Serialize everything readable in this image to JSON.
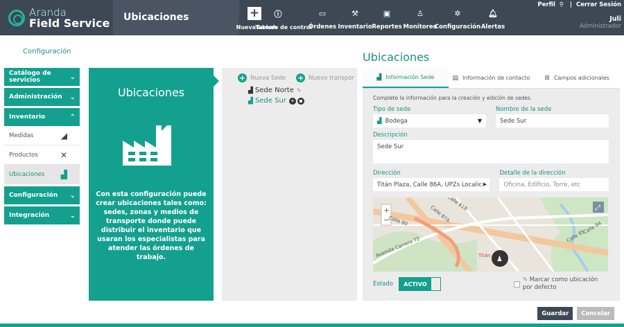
{
  "brand": {
    "line1": "Aranda",
    "line2": "Field Service"
  },
  "header": {
    "section": "Ubicaciones"
  },
  "nav": [
    {
      "label": "NuevaTareah",
      "icon": "plus-icon"
    },
    {
      "label": "Tablero de control",
      "icon": "info-icon"
    },
    {
      "label": "Órdenes",
      "icon": "window-icon"
    },
    {
      "label": "Inventario",
      "icon": "dolly-icon"
    },
    {
      "label": "Reportes",
      "icon": "report-icon"
    },
    {
      "label": "Monitoreo",
      "icon": "monitor-icon"
    },
    {
      "label": "Configuración",
      "icon": "gear-icon"
    },
    {
      "label": "Alertas",
      "icon": "bell-icon"
    }
  ],
  "user": {
    "profile": "Perfil",
    "logout": "Cerrar Sesión",
    "name": "Juli",
    "role": "Administrador"
  },
  "breadcrumb": "Configuración",
  "page_title": "Ubicaciones",
  "sidebar": {
    "groups": [
      {
        "label": "Catálogo de servicios"
      },
      {
        "label": "Administración"
      },
      {
        "label": "Inventario"
      },
      {
        "label": "Configuración"
      },
      {
        "label": "Integración"
      }
    ],
    "inventory_items": [
      {
        "label": "Medidas",
        "icon": "ruler-icon"
      },
      {
        "label": "Productos",
        "icon": "tools-icon"
      },
      {
        "label": "Ubicaciones",
        "icon": "factory-icon"
      }
    ]
  },
  "infocard": {
    "title": "Ubicaciones",
    "text": "Con esta configuración puede crear ubicaciones tales como: sedes, zonas y medios de transporte donde puede distribuir el inventario que usaran los especialistas para atender las órdenes de trabajo."
  },
  "tree": {
    "new_site": "Nueva Sede",
    "new_transport": "Nuevo transpor",
    "nodes": [
      "Sede Norte",
      "Sede Sur"
    ]
  },
  "tabs": [
    "Información Sede",
    "Información de contacto",
    "Campos adicionales"
  ],
  "form": {
    "hint": "Complete la información para la creación y edición de sedes.",
    "type_label": "Tipo de sede",
    "type_value": "Bodega",
    "name_label": "Nombre de la sede",
    "name_value": "Sede Sur",
    "desc_label": "Descripción",
    "desc_value": "Sede Sur",
    "address_label": "Dirección",
    "address_value": "Titán Plaza, Calle 86A, UPZs Localic",
    "address_detail_label": "Detalle de la dirección",
    "address_detail_placeholder": "Oficina, Edificio, Torre, etc",
    "status_label": "Estado",
    "status_value": "ACTIVO",
    "default_label": "Marcar como ubicación por defecto"
  },
  "map_labels": [
    "Calle 81B",
    "Calle 80",
    "Calle 87A",
    "Calle 95",
    "Calle 94",
    "Avenida Carrera 72",
    "Titán"
  ],
  "buttons": {
    "save": "Guardar",
    "cancel": "Cancelar"
  }
}
